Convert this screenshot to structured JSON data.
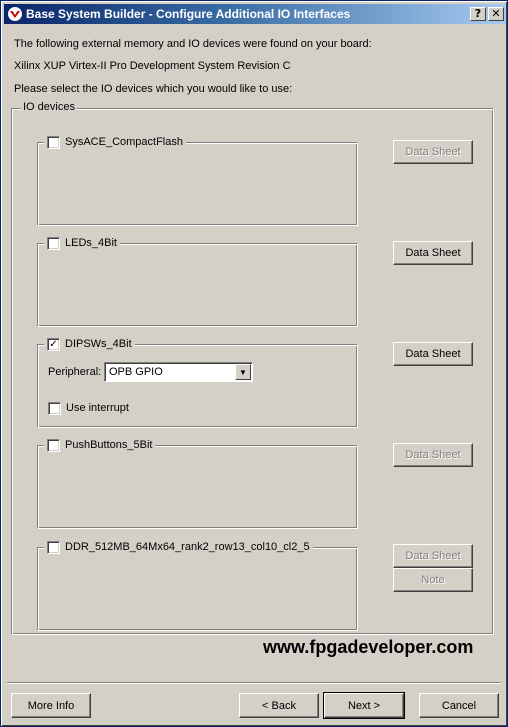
{
  "window": {
    "title": "Base System Builder - Configure Additional IO Interfaces",
    "help_glyph": "?",
    "close_glyph": "✕"
  },
  "intro": {
    "line1": "The following external memory and IO devices were found on your board:",
    "line2": "Xilinx XUP Virtex-II Pro Development System Revision C",
    "line3": "Please select the IO devices which you would like to use:"
  },
  "io_group": {
    "title": "IO devices"
  },
  "devices": [
    {
      "name": "SysACE_CompactFlash",
      "checked": false,
      "check_glyph": "",
      "datasheet_label": "Data Sheet",
      "datasheet_enabled": false
    },
    {
      "name": "LEDs_4Bit",
      "checked": false,
      "check_glyph": "",
      "datasheet_label": "Data Sheet",
      "datasheet_enabled": true
    },
    {
      "name": "DIPSWs_4Bit",
      "checked": true,
      "check_glyph": "✓",
      "datasheet_label": "Data Sheet",
      "datasheet_enabled": true,
      "peripheral_label": "Peripheral:",
      "peripheral_value": "OPB GPIO",
      "interrupt_label": "Use interrupt",
      "interrupt_checked": false
    },
    {
      "name": "PushButtons_5Bit",
      "checked": false,
      "check_glyph": "",
      "datasheet_label": "Data Sheet",
      "datasheet_enabled": false
    },
    {
      "name": "DDR_512MB_64Mx64_rank2_row13_col10_cl2_5",
      "checked": false,
      "check_glyph": "",
      "datasheet_label": "Data Sheet",
      "datasheet_enabled": false,
      "note_label": "Note",
      "note_enabled": false
    }
  ],
  "watermark": "www.fpgadeveloper.com",
  "footer": {
    "more_info": "More Info",
    "back": "< Back",
    "next": "Next >",
    "cancel": "Cancel"
  },
  "icons": {
    "title_icon": "xilinx-logo-icon",
    "dropdown": "chevron-down-icon"
  },
  "colors": {
    "title_start": "#0a246a",
    "title_end": "#a6caf0",
    "face": "#d4d0c8",
    "disabled_text": "#808080"
  }
}
